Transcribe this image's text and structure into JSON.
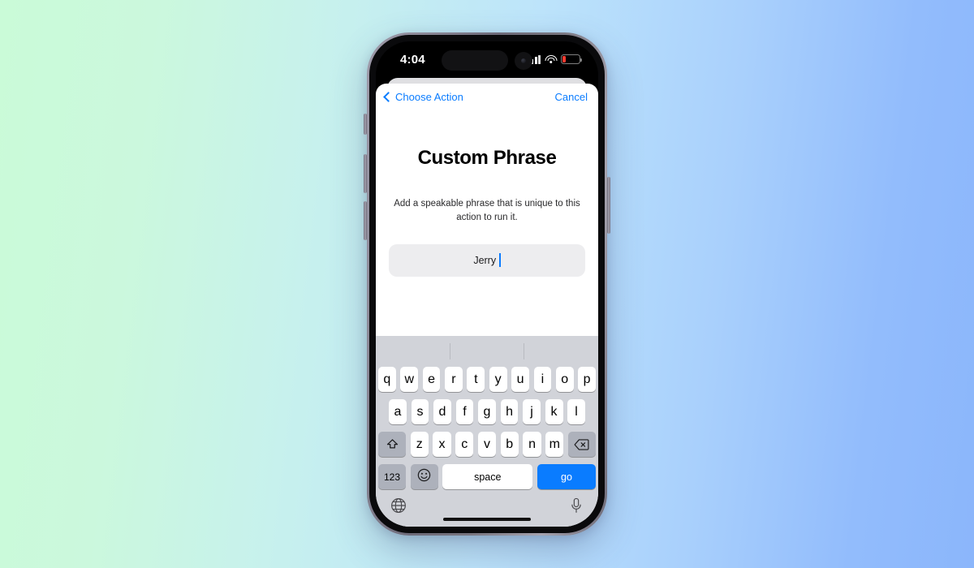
{
  "status_bar": {
    "time": "4:04",
    "cellular_icon": "cellular-signal-icon",
    "wifi_icon": "wifi-icon",
    "battery_icon": "battery-low-icon",
    "battery_color": "#ff3b30"
  },
  "nav": {
    "back_label": "Choose Action",
    "back_icon": "chevron-left-icon",
    "cancel_label": "Cancel",
    "tint_color": "#0a7cff"
  },
  "screen": {
    "title": "Custom Phrase",
    "subtitle": "Add a speakable phrase that is unique to this action to run it.",
    "text_field": {
      "value": "Jerry",
      "placeholder": "",
      "caret_color": "#0a7cff"
    }
  },
  "keyboard": {
    "predictive_suggestions": [
      "",
      "",
      ""
    ],
    "row1": [
      "q",
      "w",
      "e",
      "r",
      "t",
      "y",
      "u",
      "i",
      "o",
      "p"
    ],
    "row2": [
      "a",
      "s",
      "d",
      "f",
      "g",
      "h",
      "j",
      "k",
      "l"
    ],
    "row3": [
      "z",
      "x",
      "c",
      "v",
      "b",
      "n",
      "m"
    ],
    "shift_icon": "shift-icon",
    "backspace_icon": "backspace-icon",
    "numbers_label": "123",
    "emoji_icon": "emoji-icon",
    "space_label": "space",
    "go_label": "go",
    "go_color": "#0a7cff",
    "globe_icon": "globe-icon",
    "mic_icon": "microphone-icon"
  },
  "device": {
    "home_indicator": "home-indicator",
    "dynamic_island": "dynamic-island",
    "camera": "front-camera"
  }
}
